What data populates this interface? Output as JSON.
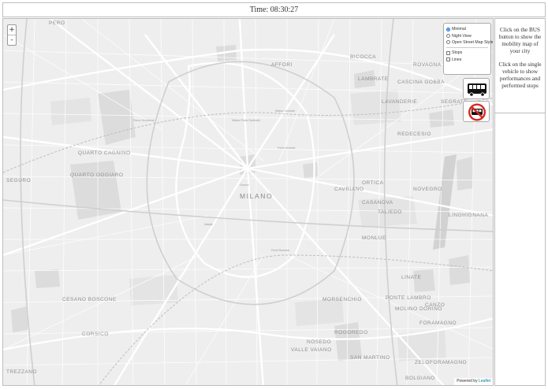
{
  "header": {
    "time_label": "Time: 08:30:27"
  },
  "map": {
    "zoom_in": "+",
    "zoom_out": "-",
    "layers": {
      "base": [
        {
          "label": "Minimal",
          "selected": true
        },
        {
          "label": "Night View",
          "selected": false
        },
        {
          "label": "Open Street Map Style",
          "selected": false
        }
      ],
      "overlays": [
        {
          "label": "Stops",
          "checked": false
        },
        {
          "label": "Lines",
          "checked": false
        }
      ]
    },
    "attribution_prefix": "Powered by",
    "attribution_link": "Leaflet",
    "places": {
      "city": "MILANO",
      "quarto_oggiaro": "QUARTO OGGIARO",
      "affori": "AFFORI",
      "bicocca": "BICOCCA",
      "rovagna": "ROVAGNA",
      "lambrate": "LAMBRATE",
      "cascina_gobba": "CASCINA GOBBA",
      "lavanderie": "LAVANDERIE",
      "segrate": "SEGRATE",
      "redecesio": "REDECESIO",
      "quarto_cagnino": "QUARTO CAGNINO",
      "seguro": "SEGURO",
      "cavriano": "CAVRIANO",
      "ortica": "ORTICA",
      "novegro": "NOVEGRO",
      "casanova": "CASANOVA",
      "taliedo": "TALIEDO",
      "linghignana": "LINGHIGNANA",
      "monlue": "MONLUE",
      "linate": "LINATE",
      "ponte_lambro": "PONTE LAMBRO",
      "molino_dorino": "MOLINO DORINO",
      "canzo": "CANZO",
      "foramagno": "FORAMAGNO",
      "morsenchio": "MORSENCHIO",
      "rogoredo": "ROGOREDO",
      "corsico": "CORSICO",
      "cesano_boscone": "CESANO BOSCONE",
      "nosedo": "NOSEDO",
      "valle_vaiano": "VALLE VAIANO",
      "san_martino": "SAN MARTINO",
      "zeloforamagno": "ZELOFORAMAGNO",
      "bolgiano": "BOLGIANO",
      "trezzano": "TREZZANO",
      "pero": "PERO",
      "duomo": "Duomo",
      "parco_sempione": "Parco Sempione",
      "porta_garibaldi": "Milano Porta Garibaldi",
      "centrale": "Milano Centrale",
      "porta_venezia": "Porta Venezia",
      "porta_romana": "Porta Romana",
      "navigli": "Navigli"
    }
  },
  "sidebar": {
    "info_1": "Click on the BUS button to show the mobility map of your city",
    "info_2": "Click on the single vehicle to show performances and performed stops"
  },
  "buttons": {
    "bus_icon": "bus-icon",
    "no_bus_icon": "no-bus-icon",
    "accent_red": "#d9261c"
  }
}
